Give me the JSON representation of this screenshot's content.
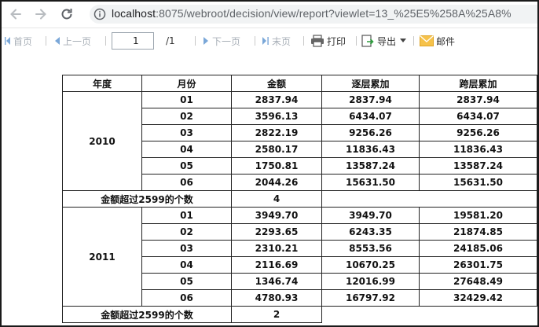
{
  "browser": {
    "url_host": "localhost",
    "url_rest": ":8075/webroot/decision/view/report?viewlet=13_%25E5%258A%25A8%"
  },
  "toolbar": {
    "first": "首页",
    "prev": "上一页",
    "page_value": "1",
    "page_total": "/1",
    "next": "下一页",
    "last": "末页",
    "print": "打印",
    "export": "导出",
    "email": "邮件"
  },
  "report": {
    "headers": [
      "年度",
      "月份",
      "金额",
      "逐层累加",
      "跨层累加"
    ],
    "summary_label": "金额超过2599的个数",
    "groups": [
      {
        "year": "2010",
        "rows": [
          [
            "01",
            "2837.94",
            "2837.94",
            "2837.94"
          ],
          [
            "02",
            "3596.13",
            "6434.07",
            "6434.07"
          ],
          [
            "03",
            "2822.19",
            "9256.26",
            "9256.26"
          ],
          [
            "04",
            "2580.17",
            "11836.43",
            "11836.43"
          ],
          [
            "05",
            "1750.81",
            "13587.24",
            "13587.24"
          ],
          [
            "06",
            "2044.26",
            "15631.50",
            "15631.50"
          ]
        ],
        "count": "4"
      },
      {
        "year": "2011",
        "rows": [
          [
            "01",
            "3949.70",
            "3949.70",
            "19581.20"
          ],
          [
            "02",
            "2293.65",
            "6243.35",
            "21874.85"
          ],
          [
            "03",
            "2310.21",
            "8553.56",
            "24185.06"
          ],
          [
            "04",
            "2116.69",
            "10670.25",
            "26301.75"
          ],
          [
            "05",
            "1346.74",
            "12016.99",
            "27648.49"
          ],
          [
            "06",
            "4780.93",
            "16797.92",
            "32429.42"
          ]
        ],
        "count": "2"
      }
    ]
  }
}
